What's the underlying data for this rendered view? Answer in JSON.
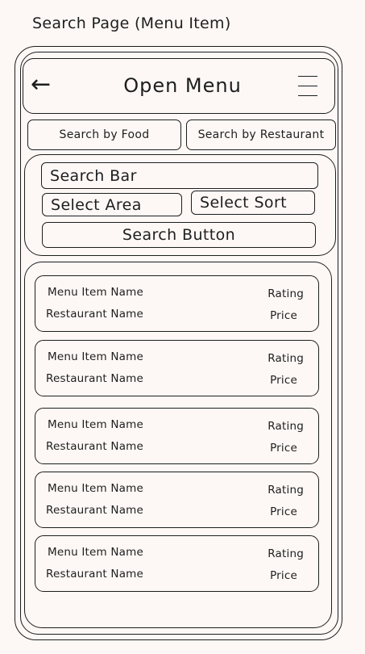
{
  "page": {
    "caption": "Search Page (Menu Item)"
  },
  "header": {
    "back_icon": "left-arrow-icon",
    "title": "Open Menu",
    "menu_icon": "hamburger-icon"
  },
  "tabs": [
    {
      "label": "Search by Food"
    },
    {
      "label": "Search by Restaurant"
    }
  ],
  "search": {
    "bar_label": "Search Bar",
    "area_label": "Select Area",
    "sort_label": "Select Sort",
    "button_label": "Search Button"
  },
  "results": [
    {
      "item": "Menu Item Name",
      "restaurant": "Restaurant Name",
      "rating": "Rating",
      "price": "Price"
    },
    {
      "item": "Menu Item Name",
      "restaurant": "Restaurant Name",
      "rating": "Rating",
      "price": "Price"
    },
    {
      "item": "Menu Item Name",
      "restaurant": "Restaurant Name",
      "rating": "Rating",
      "price": "Price"
    },
    {
      "item": "Menu Item Name",
      "restaurant": "Restaurant Name",
      "rating": "Rating",
      "price": "Price"
    },
    {
      "item": "Menu Item Name",
      "restaurant": "Restaurant Name",
      "rating": "Rating",
      "price": "Price"
    }
  ]
}
